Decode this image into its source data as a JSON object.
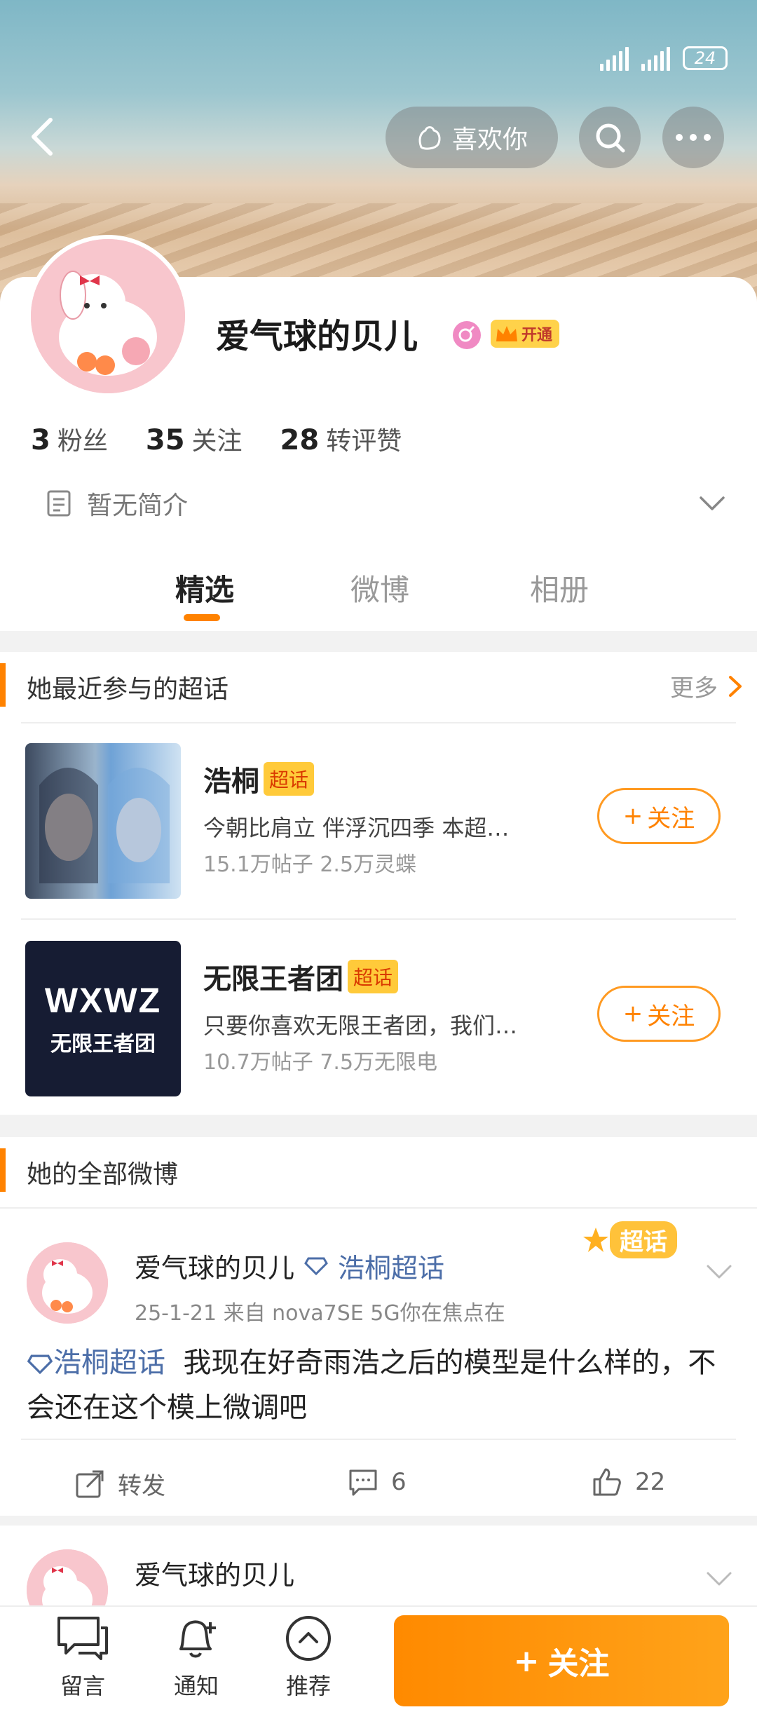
{
  "status": {
    "battery": "24"
  },
  "top": {
    "like_label": "喜欢你"
  },
  "profile": {
    "name": "爱气球的贝儿",
    "vip_label": "开通",
    "fans_count": "3",
    "fans_label": "粉丝",
    "follow_count": "35",
    "follow_label": "关注",
    "likes_count": "28",
    "likes_label": "转评赞",
    "bio": "暂无简介"
  },
  "tabs": [
    "精选",
    "微博",
    "相册"
  ],
  "topics_section": {
    "title": "她最近参与的超话",
    "more": "更多",
    "items": [
      {
        "name": "浩桐",
        "tag": "超话",
        "desc": "今朝比肩立 伴浮沉四季  本超…",
        "meta": "15.1万帖子 2.5万灵蝶",
        "follow": "关注"
      },
      {
        "name": "无限王者团",
        "tag": "超话",
        "desc": "只要你喜欢无限王者团，我们…",
        "meta": "10.7万帖子 7.5万无限电",
        "follow": "关注"
      }
    ],
    "logo_text_1": "WXWZ",
    "logo_text_2": "无限王者团"
  },
  "weibo_section": {
    "title": "她的全部微博",
    "badge": "超话",
    "posts": [
      {
        "author": "爱气球的贝儿",
        "topic": "浩桐超话",
        "meta": "25-1-21  来自 nova7SE 5G你在焦点在",
        "topic_inline": "浩桐超话",
        "text": "我现在好奇雨浩之后的模型是什么样的，不会还在这个模上微调吧",
        "repost_label": "转发",
        "comments": "6",
        "likes": "22"
      },
      {
        "author": "爱气球的贝儿"
      }
    ]
  },
  "bottom": {
    "message": "留言",
    "notify": "通知",
    "recommend": "推荐",
    "follow": "关注"
  }
}
